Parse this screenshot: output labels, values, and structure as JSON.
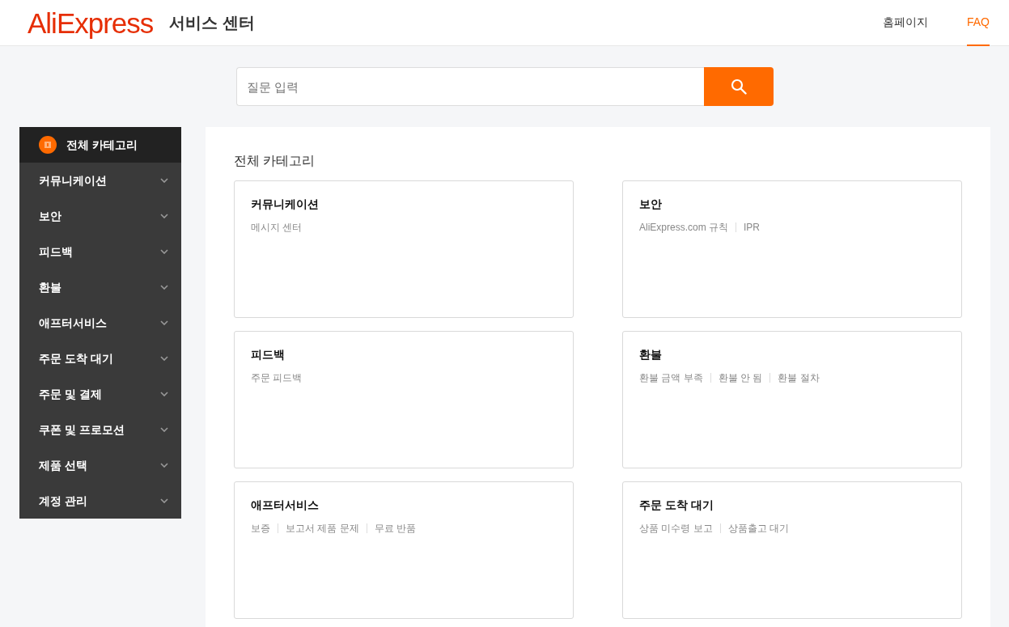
{
  "header": {
    "logo": "AliExpress",
    "title": "서비스 센터",
    "nav": [
      {
        "label": "홈페이지",
        "selected": false
      },
      {
        "label": "FAQ",
        "selected": true
      }
    ]
  },
  "search": {
    "placeholder": "질문 입력"
  },
  "sidebar": {
    "items": [
      {
        "label": "전체 카테고리",
        "kind": "all",
        "selected": true
      },
      {
        "label": "커뮤니케이션",
        "kind": "category",
        "selected": false
      },
      {
        "label": "보안",
        "kind": "category",
        "selected": false
      },
      {
        "label": "피드백",
        "kind": "category",
        "selected": false
      },
      {
        "label": "환불",
        "kind": "category",
        "selected": false
      },
      {
        "label": "애프터서비스",
        "kind": "category",
        "selected": false
      },
      {
        "label": "주문 도착 대기",
        "kind": "category",
        "selected": false
      },
      {
        "label": "주문 및 결제",
        "kind": "category",
        "selected": false
      },
      {
        "label": "쿠폰 및 프로모션",
        "kind": "category",
        "selected": false
      },
      {
        "label": "제품 선택",
        "kind": "category",
        "selected": false
      },
      {
        "label": "계정 관리",
        "kind": "category",
        "selected": false
      }
    ]
  },
  "content": {
    "title": "전체 카테고리",
    "cards": [
      {
        "title": "커뮤니케이션",
        "links": [
          "메시지 센터"
        ]
      },
      {
        "title": "보안",
        "links": [
          "AliExpress.com 규칙",
          "IPR"
        ]
      },
      {
        "title": "피드백",
        "links": [
          "주문 피드백"
        ]
      },
      {
        "title": "환불",
        "links": [
          "환불 금액 부족",
          "환불 안 됨",
          "환불 절차"
        ]
      },
      {
        "title": "애프터서비스",
        "links": [
          "보증",
          "보고서 제품 문제",
          "무료 반품"
        ]
      },
      {
        "title": "주문 도착 대기",
        "links": [
          "상품 미수령 보고",
          "상품출고 대기"
        ]
      }
    ]
  }
}
